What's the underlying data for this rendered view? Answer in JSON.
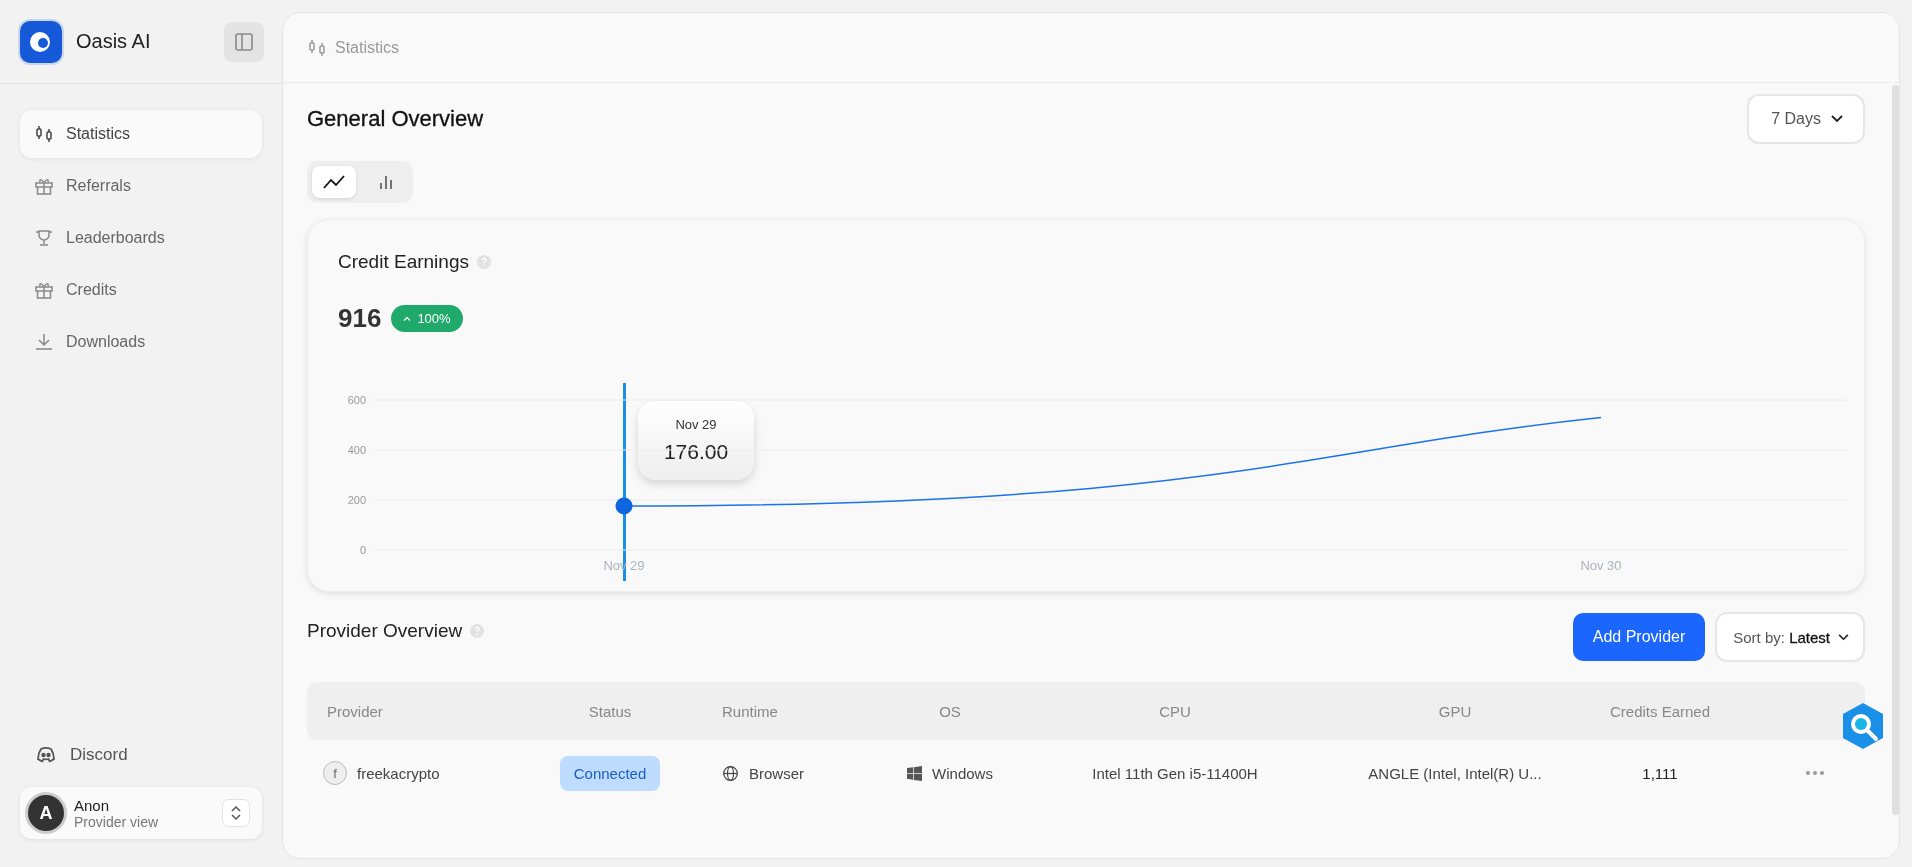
{
  "sidebar": {
    "app_name": "Oasis AI",
    "items": [
      {
        "label": "Statistics",
        "selected": true
      },
      {
        "label": "Referrals",
        "selected": false
      },
      {
        "label": "Leaderboards",
        "selected": false
      },
      {
        "label": "Credits",
        "selected": false
      },
      {
        "label": "Downloads",
        "selected": false
      }
    ],
    "footer_link": "Discord",
    "user": {
      "initial": "A",
      "name": "Anon",
      "role": "Provider view"
    }
  },
  "breadcrumb": "Statistics",
  "overview": {
    "title": "General Overview",
    "range": "7 Days",
    "chart_modes": [
      {
        "selected": true
      },
      {
        "selected": false
      }
    ]
  },
  "credit_card": {
    "title": "Credit Earnings",
    "total": "916",
    "change": "100%",
    "tooltip": {
      "label": "Nov 29",
      "value": "176.00"
    },
    "chart_data": {
      "type": "line",
      "categories": [
        "Nov 29",
        "Nov 30"
      ],
      "series": [
        {
          "color": "#1a73e8",
          "values": [
            176,
            530
          ]
        }
      ],
      "ylim": [
        0,
        600
      ],
      "yticks": [
        0,
        200,
        400,
        600
      ]
    }
  },
  "providers": {
    "title": "Provider Overview",
    "add_button": "Add Provider",
    "sort": "Sort by: **Latest**",
    "columns": [
      "Provider",
      "Status",
      "Runtime",
      "OS",
      "CPU",
      "GPU",
      "Credits Earned"
    ],
    "rows": [
      {
        "initial": "f",
        "provider": "freekacrypto",
        "status": "Connected",
        "runtime": "Browser",
        "os": "Windows",
        "cpu": "Intel 11th Gen i5-11400H",
        "gpu": "ANGLE (Intel, Intel(R) U...",
        "credits": "1,111"
      }
    ]
  }
}
